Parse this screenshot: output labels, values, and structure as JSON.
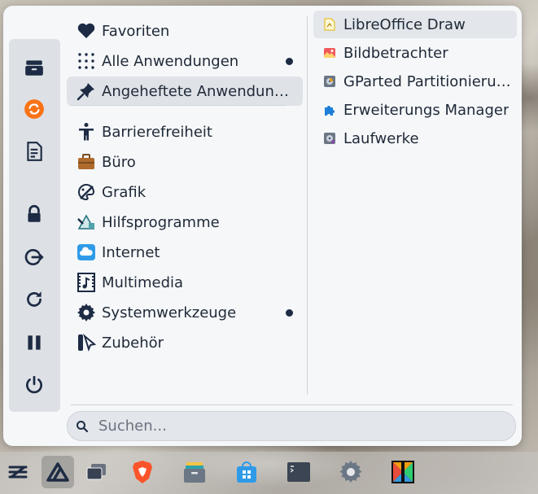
{
  "sidebar": {
    "buttons": [
      {
        "name": "file-manager-icon"
      },
      {
        "name": "software-update-icon"
      },
      {
        "name": "text-editor-icon"
      },
      {
        "name": "lock-icon"
      },
      {
        "name": "logout-icon"
      },
      {
        "name": "restart-icon"
      },
      {
        "name": "suspend-icon"
      },
      {
        "name": "power-icon"
      }
    ]
  },
  "categories": {
    "items": [
      {
        "label": "Favoriten",
        "icon": "heart-icon",
        "dot": false,
        "selected": false
      },
      {
        "label": "Alle Anwendungen",
        "icon": "grid-icon",
        "dot": true,
        "selected": false
      },
      {
        "label": "Angeheftete Anwendung...",
        "icon": "pin-icon",
        "dot": false,
        "selected": true
      },
      {
        "label": "Barrierefreiheit",
        "icon": "accessibility-icon",
        "dot": false,
        "selected": false
      },
      {
        "label": "Büro",
        "icon": "briefcase-icon",
        "dot": false,
        "selected": false
      },
      {
        "label": "Grafik",
        "icon": "graphics-icon",
        "dot": false,
        "selected": false
      },
      {
        "label": "Hilfsprogramme",
        "icon": "utilities-icon",
        "dot": false,
        "selected": false
      },
      {
        "label": "Internet",
        "icon": "cloud-icon",
        "dot": false,
        "selected": false
      },
      {
        "label": "Multimedia",
        "icon": "multimedia-icon",
        "dot": false,
        "selected": false
      },
      {
        "label": "Systemwerkzeuge",
        "icon": "gear-icon",
        "dot": true,
        "selected": false
      },
      {
        "label": "Zubehör",
        "icon": "accessories-icon",
        "dot": false,
        "selected": false
      }
    ]
  },
  "apps": {
    "items": [
      {
        "label": "LibreOffice Draw",
        "icon": "libreoffice-draw-icon",
        "selected": true
      },
      {
        "label": "Bildbetrachter",
        "icon": "image-viewer-icon",
        "selected": false
      },
      {
        "label": "GParted Partitionierun...",
        "icon": "gparted-icon",
        "selected": false
      },
      {
        "label": "Erweiterungs Manager",
        "icon": "puzzle-icon",
        "selected": false
      },
      {
        "label": "Laufwerke",
        "icon": "disks-icon",
        "selected": false
      }
    ]
  },
  "search": {
    "placeholder": "Suchen..."
  },
  "taskbar": {
    "items": [
      {
        "name": "zorin-menu-icon",
        "active": false
      },
      {
        "name": "zorin-app-icon",
        "active": true
      },
      {
        "name": "workspaces-icon",
        "active": false
      },
      {
        "name": "brave-browser-icon",
        "active": false
      },
      {
        "name": "files-icon",
        "active": false
      },
      {
        "name": "software-store-icon",
        "active": false
      },
      {
        "name": "terminal-icon",
        "active": false
      },
      {
        "name": "settings-icon",
        "active": false
      },
      {
        "name": "multicolor-app-icon",
        "active": false
      }
    ]
  },
  "colors": {
    "accent_dark": "#1d2b44",
    "menu_bg": "#f5f7f9",
    "selection_bg": "#dfe3e8"
  }
}
